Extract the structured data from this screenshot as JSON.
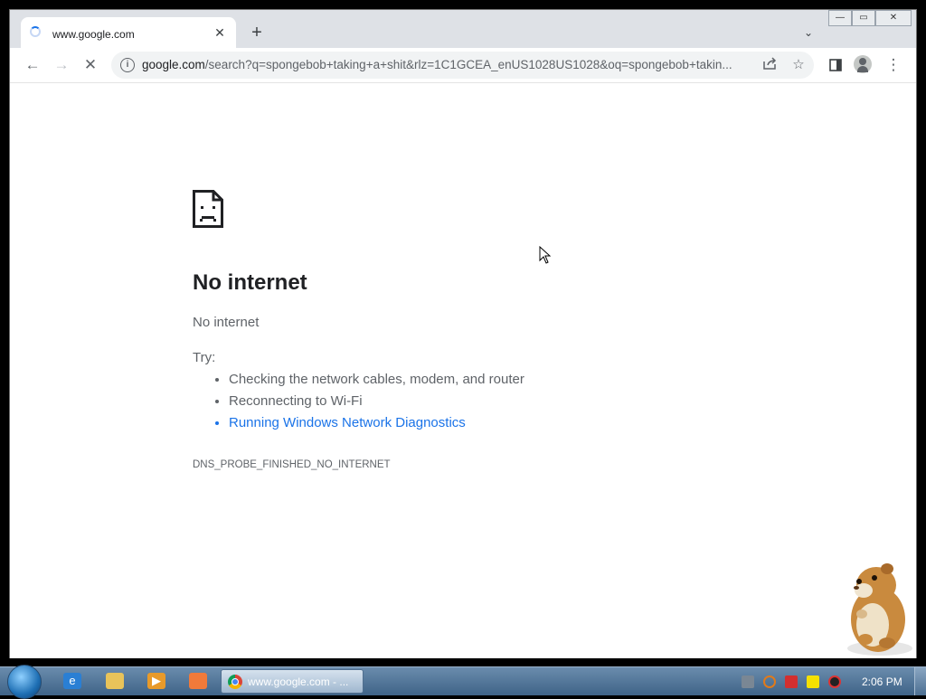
{
  "browser": {
    "tab": {
      "title": "www.google.com",
      "close_glyph": "✕"
    },
    "new_tab_glyph": "+",
    "tab_search_glyph": "⌄",
    "window_controls": {
      "minimize": "—",
      "maximize": "▭",
      "close": "✕"
    },
    "toolbar": {
      "back_glyph": "←",
      "forward_glyph": "→",
      "stop_glyph": "✕",
      "share_icon": "share-icon",
      "star_glyph": "☆",
      "side_panel_icon": "side-panel-icon",
      "menu_glyph": "⋮"
    },
    "omnibox": {
      "host": "google.com",
      "rest": "/search?q=spongebob+taking+a+shit&rlz=1C1GCEA_enUS1028US1028&oq=spongebob+takin..."
    }
  },
  "error_page": {
    "title": "No internet",
    "subtitle": "No internet",
    "try_label": "Try:",
    "suggestions": [
      "Checking the network cables, modem, and router",
      "Reconnecting to Wi-Fi",
      "Running Windows Network Diagnostics"
    ],
    "error_code": "DNS_PROBE_FINISHED_NO_INTERNET"
  },
  "taskbar": {
    "pinned_icons": [
      "internet-explorer-icon",
      "file-explorer-icon",
      "media-player-icon",
      "app-icon"
    ],
    "active_task_label": "www.google.com - ...",
    "tray_icons": [
      "tray-app-icon",
      "search-tray-icon",
      "flag-icon",
      "note-icon",
      "volume-icon"
    ],
    "clock": "2:06 PM"
  },
  "colors": {
    "link": "#1a73e8",
    "text_primary": "#202124",
    "text_secondary": "#5f6368",
    "tab_strip": "#dee1e6"
  }
}
